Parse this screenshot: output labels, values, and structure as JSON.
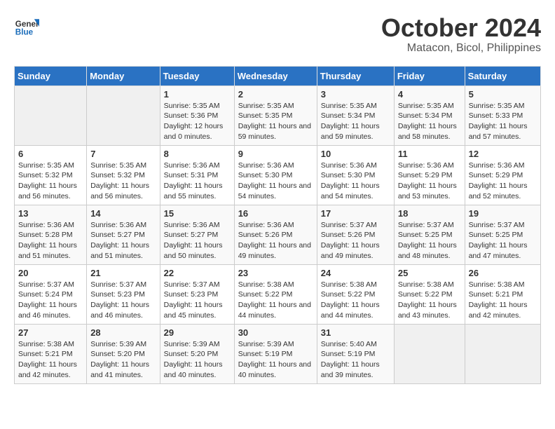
{
  "header": {
    "logo_line1": "General",
    "logo_line2": "Blue",
    "month_title": "October 2024",
    "subtitle": "Matacon, Bicol, Philippines"
  },
  "days_of_week": [
    "Sunday",
    "Monday",
    "Tuesday",
    "Wednesday",
    "Thursday",
    "Friday",
    "Saturday"
  ],
  "weeks": [
    [
      {
        "day": "",
        "empty": true
      },
      {
        "day": "",
        "empty": true
      },
      {
        "day": "1",
        "sunrise": "5:35 AM",
        "sunset": "5:36 PM",
        "daylight": "12 hours and 0 minutes."
      },
      {
        "day": "2",
        "sunrise": "5:35 AM",
        "sunset": "5:35 PM",
        "daylight": "11 hours and 59 minutes."
      },
      {
        "day": "3",
        "sunrise": "5:35 AM",
        "sunset": "5:34 PM",
        "daylight": "11 hours and 59 minutes."
      },
      {
        "day": "4",
        "sunrise": "5:35 AM",
        "sunset": "5:34 PM",
        "daylight": "11 hours and 58 minutes."
      },
      {
        "day": "5",
        "sunrise": "5:35 AM",
        "sunset": "5:33 PM",
        "daylight": "11 hours and 57 minutes."
      }
    ],
    [
      {
        "day": "6",
        "sunrise": "5:35 AM",
        "sunset": "5:32 PM",
        "daylight": "11 hours and 56 minutes."
      },
      {
        "day": "7",
        "sunrise": "5:35 AM",
        "sunset": "5:32 PM",
        "daylight": "11 hours and 56 minutes."
      },
      {
        "day": "8",
        "sunrise": "5:36 AM",
        "sunset": "5:31 PM",
        "daylight": "11 hours and 55 minutes."
      },
      {
        "day": "9",
        "sunrise": "5:36 AM",
        "sunset": "5:30 PM",
        "daylight": "11 hours and 54 minutes."
      },
      {
        "day": "10",
        "sunrise": "5:36 AM",
        "sunset": "5:30 PM",
        "daylight": "11 hours and 54 minutes."
      },
      {
        "day": "11",
        "sunrise": "5:36 AM",
        "sunset": "5:29 PM",
        "daylight": "11 hours and 53 minutes."
      },
      {
        "day": "12",
        "sunrise": "5:36 AM",
        "sunset": "5:29 PM",
        "daylight": "11 hours and 52 minutes."
      }
    ],
    [
      {
        "day": "13",
        "sunrise": "5:36 AM",
        "sunset": "5:28 PM",
        "daylight": "11 hours and 51 minutes."
      },
      {
        "day": "14",
        "sunrise": "5:36 AM",
        "sunset": "5:27 PM",
        "daylight": "11 hours and 51 minutes."
      },
      {
        "day": "15",
        "sunrise": "5:36 AM",
        "sunset": "5:27 PM",
        "daylight": "11 hours and 50 minutes."
      },
      {
        "day": "16",
        "sunrise": "5:36 AM",
        "sunset": "5:26 PM",
        "daylight": "11 hours and 49 minutes."
      },
      {
        "day": "17",
        "sunrise": "5:37 AM",
        "sunset": "5:26 PM",
        "daylight": "11 hours and 49 minutes."
      },
      {
        "day": "18",
        "sunrise": "5:37 AM",
        "sunset": "5:25 PM",
        "daylight": "11 hours and 48 minutes."
      },
      {
        "day": "19",
        "sunrise": "5:37 AM",
        "sunset": "5:25 PM",
        "daylight": "11 hours and 47 minutes."
      }
    ],
    [
      {
        "day": "20",
        "sunrise": "5:37 AM",
        "sunset": "5:24 PM",
        "daylight": "11 hours and 46 minutes."
      },
      {
        "day": "21",
        "sunrise": "5:37 AM",
        "sunset": "5:23 PM",
        "daylight": "11 hours and 46 minutes."
      },
      {
        "day": "22",
        "sunrise": "5:37 AM",
        "sunset": "5:23 PM",
        "daylight": "11 hours and 45 minutes."
      },
      {
        "day": "23",
        "sunrise": "5:38 AM",
        "sunset": "5:22 PM",
        "daylight": "11 hours and 44 minutes."
      },
      {
        "day": "24",
        "sunrise": "5:38 AM",
        "sunset": "5:22 PM",
        "daylight": "11 hours and 44 minutes."
      },
      {
        "day": "25",
        "sunrise": "5:38 AM",
        "sunset": "5:22 PM",
        "daylight": "11 hours and 43 minutes."
      },
      {
        "day": "26",
        "sunrise": "5:38 AM",
        "sunset": "5:21 PM",
        "daylight": "11 hours and 42 minutes."
      }
    ],
    [
      {
        "day": "27",
        "sunrise": "5:38 AM",
        "sunset": "5:21 PM",
        "daylight": "11 hours and 42 minutes."
      },
      {
        "day": "28",
        "sunrise": "5:39 AM",
        "sunset": "5:20 PM",
        "daylight": "11 hours and 41 minutes."
      },
      {
        "day": "29",
        "sunrise": "5:39 AM",
        "sunset": "5:20 PM",
        "daylight": "11 hours and 40 minutes."
      },
      {
        "day": "30",
        "sunrise": "5:39 AM",
        "sunset": "5:19 PM",
        "daylight": "11 hours and 40 minutes."
      },
      {
        "day": "31",
        "sunrise": "5:40 AM",
        "sunset": "5:19 PM",
        "daylight": "11 hours and 39 minutes."
      },
      {
        "day": "",
        "empty": true
      },
      {
        "day": "",
        "empty": true
      }
    ]
  ]
}
